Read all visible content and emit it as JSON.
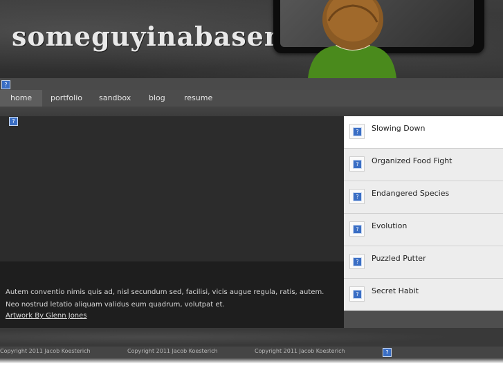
{
  "header": {
    "logo_text": "someguyinabasement"
  },
  "nav": {
    "items": [
      {
        "label": "home",
        "active": true
      },
      {
        "label": "portfolio",
        "active": false
      },
      {
        "label": "sandbox",
        "active": false
      },
      {
        "label": "blog",
        "active": false
      },
      {
        "label": "resume",
        "active": false
      }
    ]
  },
  "main": {
    "caption_text": "Autem conventio nimis quis ad, nisl secundum sed, facilisi, vicis augue regula, ratis, autem. Neo nostrud letatio aliquam validus eum quadrum, volutpat et.",
    "artwork_link": "Artwork By Glenn Jones"
  },
  "sidebar": {
    "items": [
      {
        "title": "Slowing Down",
        "selected": true
      },
      {
        "title": "Organized Food Fight",
        "selected": false
      },
      {
        "title": "Endangered Species",
        "selected": false
      },
      {
        "title": "Evolution",
        "selected": false
      },
      {
        "title": "Puzzled Putter",
        "selected": false
      },
      {
        "title": "Secret Habit",
        "selected": false
      }
    ]
  },
  "footer": {
    "copyrights": [
      "Copyright 2011 Jacob Koesterich",
      "Copyright 2011 Jacob Koesterich",
      "Copyright 2011 Jacob Koesterich"
    ]
  },
  "broken_image_glyph": "?",
  "colors": {
    "nav_bg": "#4c4c4c",
    "nav_active": "#5d5d5d",
    "main_bg": "#2c2c2c",
    "caption_bg": "#1e1e1e",
    "sidebar_item": "#ededed",
    "sidebar_selected": "#ffffff",
    "broken_icon": "#3a6ec4"
  }
}
